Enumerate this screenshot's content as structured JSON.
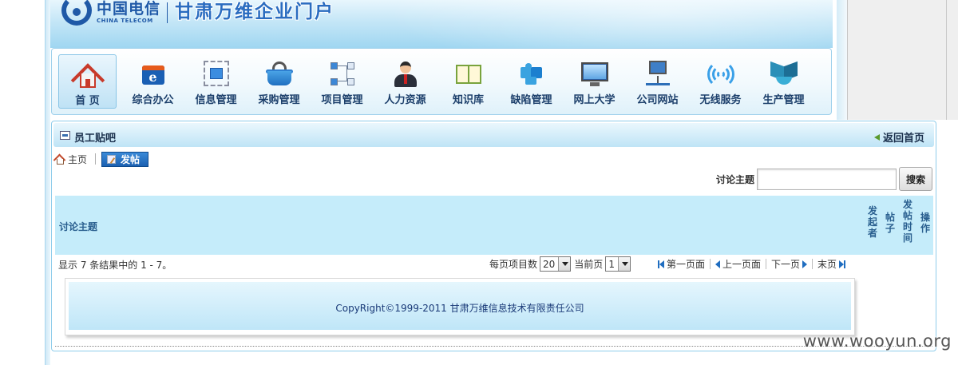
{
  "header": {
    "logo_cn": "中国电信",
    "logo_en": "CHINA TELECOM",
    "site_title": "甘肃万维企业门户"
  },
  "nav": {
    "items": [
      {
        "label": "首 页",
        "icon": "home-icon"
      },
      {
        "label": "综合办公",
        "icon": "office-icon"
      },
      {
        "label": "信息管理",
        "icon": "info-management-icon"
      },
      {
        "label": "采购管理",
        "icon": "basket-icon"
      },
      {
        "label": "项目管理",
        "icon": "flowchart-icon"
      },
      {
        "label": "人力资源",
        "icon": "person-icon"
      },
      {
        "label": "知识库",
        "icon": "book-icon"
      },
      {
        "label": "缺陷管理",
        "icon": "puzzle-icon"
      },
      {
        "label": "网上大学",
        "icon": "monitor-icon"
      },
      {
        "label": "公司网站",
        "icon": "network-computer-icon"
      },
      {
        "label": "无线服务",
        "icon": "wireless-icon"
      },
      {
        "label": "生产管理",
        "icon": "production-icon"
      }
    ],
    "active_index": 0
  },
  "panel": {
    "title": "员工贴吧",
    "back_label": "返回首页",
    "breadcrumb_home": "主页",
    "post_button": "发帖"
  },
  "search": {
    "label": "讨论主题",
    "value": "",
    "button": "搜索"
  },
  "table": {
    "columns": [
      "讨论主题",
      "发起者",
      "帖子",
      "发帖时间",
      "操作"
    ]
  },
  "results": {
    "summary": "显示 7 条结果中的 1 - 7。"
  },
  "pager": {
    "per_page_label": "每页项目数",
    "per_page_value": "20",
    "current_page_label": "当前页",
    "current_page_value": "1",
    "first": "第一页面",
    "prev": "上一页面",
    "next": "下一页",
    "last": "末页"
  },
  "footer": {
    "copyright": "CopyRight©1999-2011 甘肃万维信息技术有限责任公司"
  },
  "watermark": "www.wooyun.org",
  "colors": {
    "accent": "#1f59a7",
    "header_bg": "#c4e6f7",
    "table_header_bg": "#c5ecfa"
  }
}
